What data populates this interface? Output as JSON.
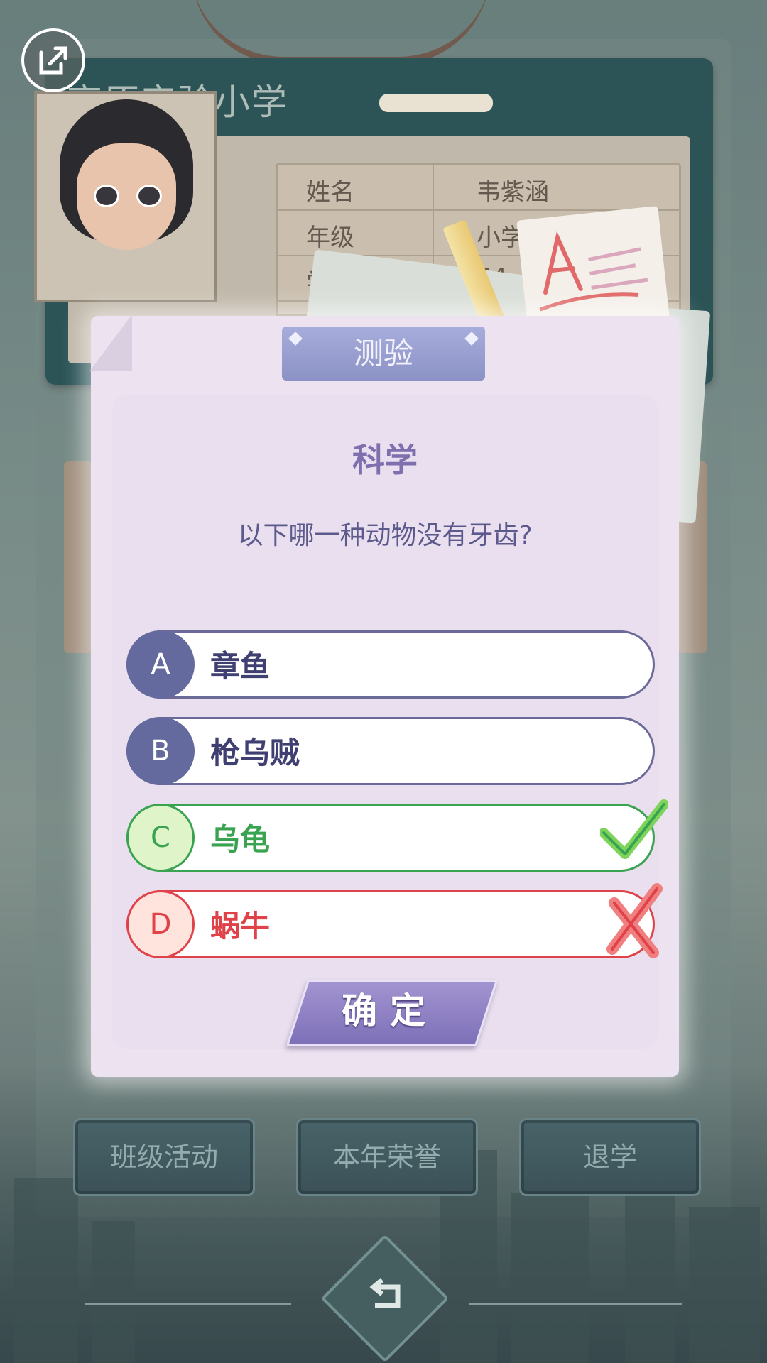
{
  "id_card": {
    "school_name": "高原实验小学",
    "fields": [
      {
        "label": "姓名",
        "value": "韦紫涵"
      },
      {
        "label": "年级",
        "value": "小学"
      },
      {
        "label": "学",
        "value": "64"
      }
    ]
  },
  "dialog": {
    "title": "测验",
    "subject": "科学",
    "question": "以下哪一种动物没有牙齿?",
    "options": [
      {
        "letter": "A",
        "text": "章鱼",
        "state": "normal"
      },
      {
        "letter": "B",
        "text": "枪乌贼",
        "state": "normal"
      },
      {
        "letter": "C",
        "text": "乌龟",
        "state": "correct"
      },
      {
        "letter": "D",
        "text": "蜗牛",
        "state": "wrong"
      }
    ],
    "confirm_label": "确定"
  },
  "bottom_buttons": [
    "班级活动",
    "本年荣誉",
    "退学"
  ],
  "icons": {
    "share": "share-external-icon",
    "back": "return-arrow-icon",
    "correct": "check-mark-icon",
    "wrong": "cross-mark-icon"
  },
  "colors": {
    "correct": "#3aa351",
    "wrong": "#e0424a",
    "option_letter_bg": "#656a9e",
    "title_tab": "#9aa0d0",
    "confirm_button": "#8d80c4"
  }
}
